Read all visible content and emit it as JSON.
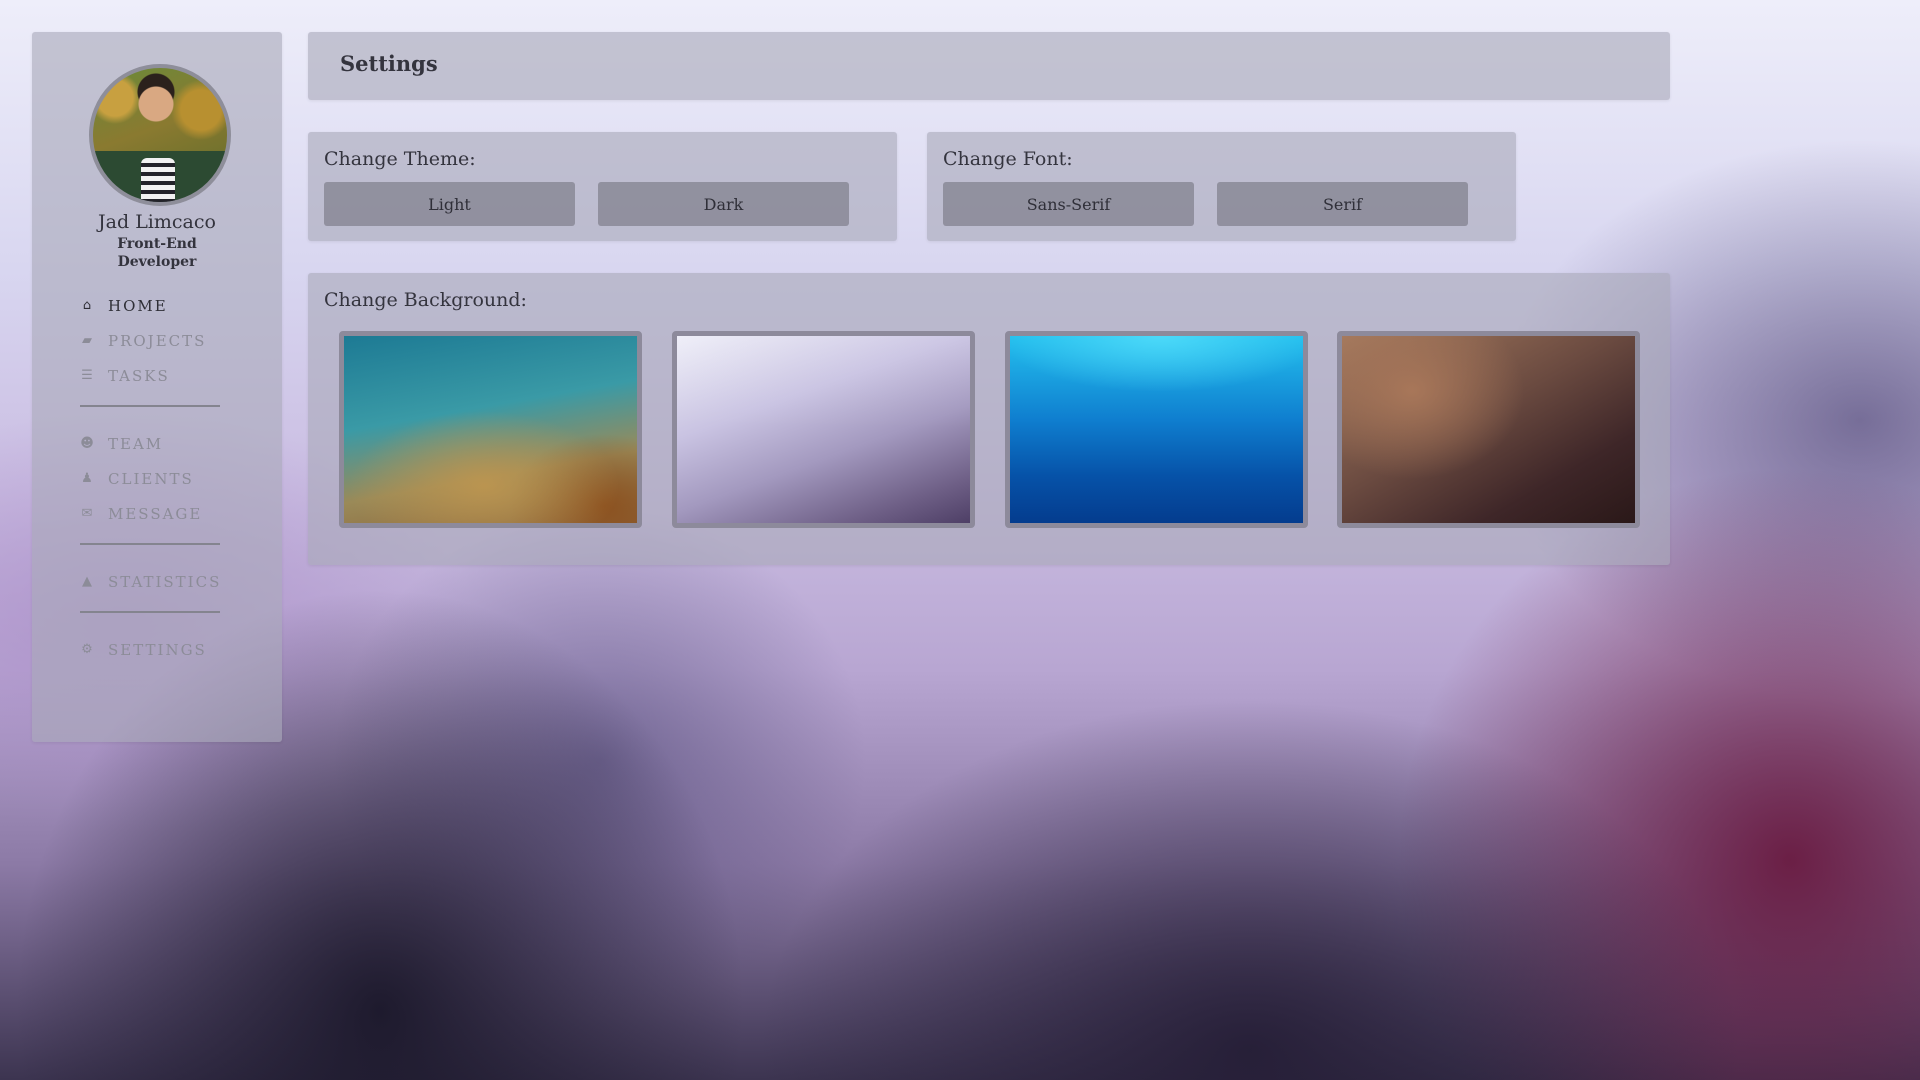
{
  "profile": {
    "name": "Jad Limcaco",
    "role": "Front-End Developer",
    "avatar": "avatar-photo"
  },
  "nav": {
    "groups": [
      [
        {
          "icon": "home-icon",
          "glyph": "⌂",
          "label": "HOME",
          "active": true
        },
        {
          "icon": "briefcase-icon",
          "glyph": "▰",
          "label": "PROJECTS",
          "active": false
        },
        {
          "icon": "tasks-icon",
          "glyph": "☰",
          "label": "TASKS",
          "active": false
        }
      ],
      [
        {
          "icon": "team-icon",
          "glyph": "☻",
          "label": "TEAM",
          "active": false
        },
        {
          "icon": "clients-icon",
          "glyph": "♟",
          "label": "CLIENTS",
          "active": false
        },
        {
          "icon": "message-icon",
          "glyph": "✉",
          "label": "MESSAGE",
          "active": false
        }
      ],
      [
        {
          "icon": "statistics-icon",
          "glyph": "▲",
          "label": "STATISTICS",
          "active": false
        }
      ],
      [
        {
          "icon": "settings-icon",
          "glyph": "⚙",
          "label": "SETTINGS",
          "active": false
        }
      ]
    ]
  },
  "header": {
    "title": "Settings"
  },
  "theme": {
    "label": "Change Theme:",
    "options": [
      "Light",
      "Dark"
    ]
  },
  "font": {
    "label": "Change Font:",
    "options": [
      "Sans-Serif",
      "Serif"
    ]
  },
  "background": {
    "label": "Change Background:",
    "thumbnails": [
      {
        "name": "teal-gold-blur"
      },
      {
        "name": "lavender-blur"
      },
      {
        "name": "blue-gradient"
      },
      {
        "name": "brown-blur"
      }
    ]
  },
  "colors": {
    "panel": "#aaaab9",
    "button": "#80808c",
    "active_nav": "#2e2e36",
    "inactive_nav": "#8c8c98"
  }
}
